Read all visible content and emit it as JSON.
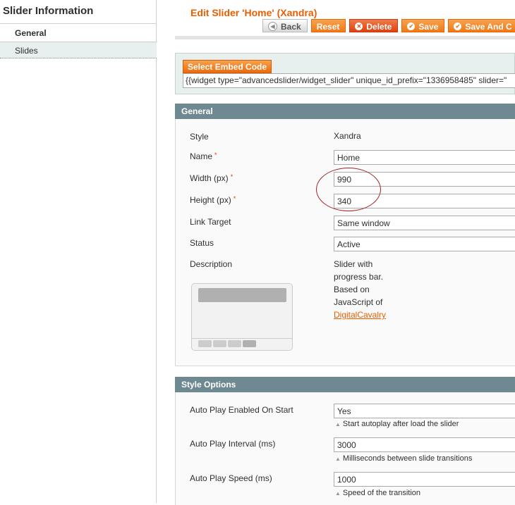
{
  "sidebar": {
    "title": "Slider Information",
    "tabs": [
      {
        "label": "General",
        "active": true
      },
      {
        "label": "Slides",
        "active": false
      }
    ]
  },
  "header": {
    "title": "Edit Slider 'Home' (Xandra)",
    "buttons": {
      "back": "Back",
      "reset": "Reset",
      "delete": "Delete",
      "save": "Save",
      "save_continue": "Save And C"
    }
  },
  "embed": {
    "button_label": "Select Embed Code",
    "code": "{{widget type=\"advancedslider/widget_slider\" unique_id_prefix=\"1336958485\" slider=\""
  },
  "general": {
    "title": "General",
    "style_label": "Style",
    "style_value": "Xandra",
    "name_label": "Name",
    "name_value": "Home",
    "width_label": "Width (px)",
    "width_value": "990",
    "height_label": "Height (px)",
    "height_value": "340",
    "link_target_label": "Link Target",
    "link_target_value": "Same window",
    "status_label": "Status",
    "status_value": "Active",
    "description_label": "Description",
    "description_lines": [
      "Slider with",
      "progress bar.",
      "Based on",
      "JavaScript of"
    ],
    "description_link": "DigitalCavalry",
    "required_mark": "*"
  },
  "style_options": {
    "title": "Style Options",
    "autoplay_enabled_label": "Auto Play Enabled On Start",
    "autoplay_enabled_value": "Yes",
    "autoplay_enabled_note": "Start autoplay after load the slider",
    "autoplay_interval_label": "Auto Play Interval (ms)",
    "autoplay_interval_value": "3000",
    "autoplay_interval_note": "Milliseconds between slide transitions",
    "autoplay_speed_label": "Auto Play Speed (ms)",
    "autoplay_speed_value": "1000",
    "autoplay_speed_note": "Speed of the transition"
  },
  "colors": {
    "accent": "#eb5e00",
    "section_header": "#6f8992",
    "annotation": "#a0252a"
  }
}
